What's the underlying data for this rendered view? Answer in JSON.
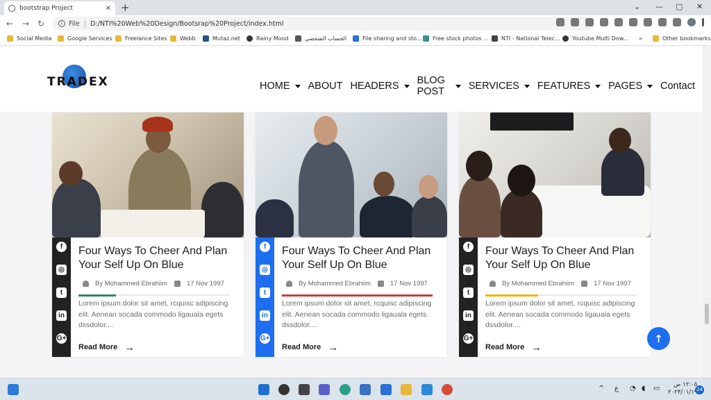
{
  "browser": {
    "tab_title": "bootstrap Project",
    "new_tab": "+",
    "url_scheme": "File",
    "url": "D:/NTI%20Web%20Design/Bootsrap%20Project/index.html",
    "bookmarks": [
      "Social Media",
      "Google Services",
      "Freelance Sites",
      "Webb",
      "Mutaz.net",
      "Rainy Mood",
      "الحساب الشخصي",
      "File sharing and sto...",
      "Free stock photos ...",
      "NTI - National Telec...",
      "Youtube Multi Dow...",
      "»",
      "Other bookmarks"
    ]
  },
  "site": {
    "logo_text": "TRADEX",
    "nav": [
      "HOME",
      "ABOUT",
      "HEADERS",
      "BLOG POST",
      "SERVICES",
      "FEATURES",
      "PAGES",
      "Contact"
    ]
  },
  "cards": [
    {
      "title": "Four Ways To Cheer And Plan Your Self Up On Blue",
      "author": "By Mohammed Ebrahiim",
      "date": "17 Nov 1997",
      "excerpt": "Lorem ipsum dolor sit amet, rcquisc adipiscing elit. Aenean socada commodo ligauala egets dssdolor....",
      "read_more": "Read More",
      "accent": "#2e8b57",
      "sidebar": "#222222",
      "progress": 0.25
    },
    {
      "title": "Four Ways To Cheer And Plan Your Self Up On Blue",
      "author": "By Mohammed Ebrahiim",
      "date": "17 Nov 1997",
      "excerpt": "Lorem ipsum dolor sit amet, rcquisc adipiscing elit. Aenean socada commodo ligauala egets dssdolor....",
      "read_more": "Read More",
      "accent": "#d23c3c",
      "sidebar": "#1e6ef0",
      "progress": 1.0
    },
    {
      "title": "Four Ways To Cheer And Plan Your Self Up On Blue",
      "author": "By Mohammed Ebrahiim",
      "date": "17 Nov 1997",
      "excerpt": "Lorem ipsum dolor sit amet, rcquisc adipiscing elit. Aenean socada commodo ligauala egets dssdolor....",
      "read_more": "Read More",
      "accent": "#f0b400",
      "sidebar": "#222222",
      "progress": 0.35
    }
  ],
  "social_icons": [
    "facebook-icon",
    "instagram-icon",
    "twitter-icon",
    "linkedin-icon",
    "google-plus-icon"
  ],
  "social_glyphs": [
    "f",
    "◎",
    "t",
    "in",
    "G+"
  ],
  "scroll_top": "↑",
  "taskbar": {
    "lang": "ع",
    "time": "١٢:٠٥ ص",
    "date": "٢٠٢٣/٠١/١٩",
    "notifications": "24"
  }
}
